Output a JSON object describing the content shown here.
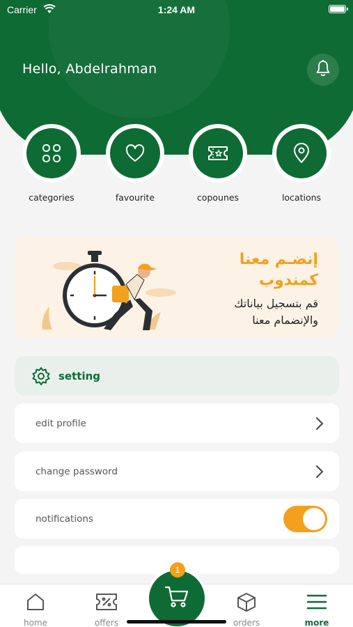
{
  "status_bar": {
    "carrier": "Carrier",
    "time": "1:24 AM"
  },
  "header": {
    "greeting": "Hello,  Abdelrahman"
  },
  "quick_actions": [
    {
      "label": "categories",
      "icon": "grid-icon"
    },
    {
      "label": "favourite",
      "icon": "heart-icon"
    },
    {
      "label": "copounes",
      "icon": "coupon-icon"
    },
    {
      "label": "locations",
      "icon": "location-pin-icon"
    }
  ],
  "banner": {
    "title_line1": "إنضـم معنا",
    "title_line2": "كمندوب",
    "sub_line1": "قم بتسجيل بياناتك",
    "sub_line2": "والإنضمام معنا"
  },
  "settings": {
    "header": "setting",
    "rows": [
      {
        "label": "edit profile"
      },
      {
        "label": "change password"
      },
      {
        "label": "notifications"
      }
    ],
    "notifications_enabled": true
  },
  "bottom_nav": {
    "items": [
      {
        "label": "home"
      },
      {
        "label": "offers"
      },
      {
        "label": "orders"
      },
      {
        "label": "more"
      }
    ],
    "active": "more",
    "cart_badge": "1"
  },
  "colors": {
    "brand": "#0e6b34",
    "accent": "#f2a01e",
    "banner_bg": "#fcf2e5"
  }
}
